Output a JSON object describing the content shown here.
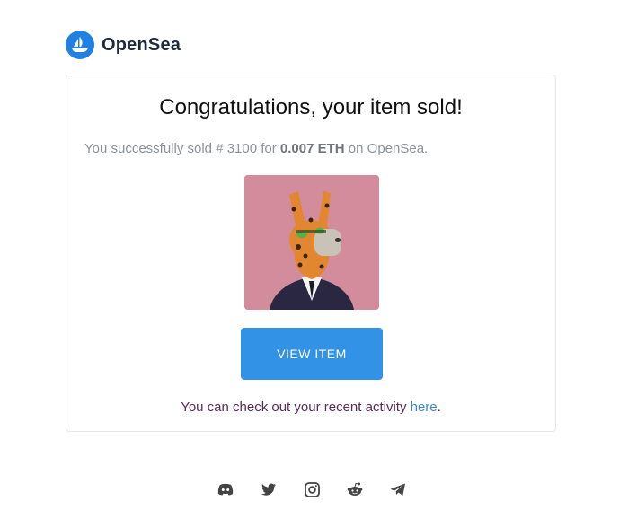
{
  "brand": {
    "name": "OpenSea",
    "color": "#2081e2"
  },
  "card": {
    "title": "Congratulations, your item sold!",
    "subtitle_prefix": "You successfully sold # 3100 for ",
    "price": "0.007 ETH",
    "subtitle_suffix": " on OpenSea.",
    "button_label": "VIEW ITEM",
    "activity_prefix": "You can check out your recent activity ",
    "activity_link": "here",
    "activity_suffix": ".",
    "button_color": "#3292e6",
    "image_bg": "#d28c9c"
  },
  "footer": {
    "socials": [
      "discord-icon",
      "twitter-icon",
      "instagram-icon",
      "reddit-icon",
      "telegram-icon"
    ]
  }
}
